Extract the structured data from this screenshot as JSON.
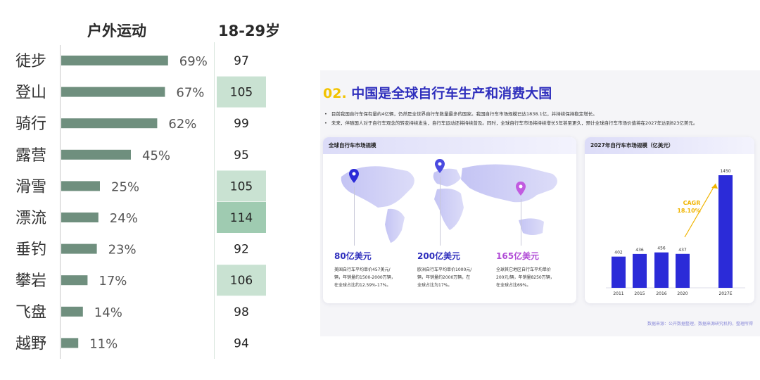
{
  "left": {
    "header_left": "户外运动",
    "header_right": "18-29岁",
    "colors": {
      "bar": "#6f8f7e",
      "hl_light": "#c9e2d2",
      "hl_strong": "#9fcbb1"
    },
    "chart_data": {
      "type": "bar",
      "categories": [
        "徒步",
        "登山",
        "骑行",
        "露营",
        "滑雪",
        "漂流",
        "垂钓",
        "攀岩",
        "飞盘",
        "越野"
      ],
      "values": [
        69,
        67,
        62,
        45,
        25,
        24,
        23,
        17,
        14,
        11
      ],
      "value_labels": [
        "69%",
        "67%",
        "62%",
        "45%",
        "25%",
        "24%",
        "23%",
        "17%",
        "14%",
        "11%"
      ],
      "age_18_29_index": [
        "97",
        "105",
        "99",
        "95",
        "105",
        "114",
        "92",
        "106",
        "98",
        "94"
      ],
      "highlight": [
        "none",
        "light",
        "none",
        "none",
        "light",
        "strong",
        "none",
        "light",
        "none",
        "none"
      ],
      "title": "户外运动",
      "column_title": "18-29岁"
    }
  },
  "right": {
    "title_num": "02.",
    "title_text": "中国是全球自行车生产和消费大国",
    "bullets": [
      "目前我国自行车保有量约4亿辆，仍然是全世界自行车数量最多的国家。我国自行车市场规模已达1838.1亿，并持续保持稳定增长。",
      "未来，伴随国人对于自行车观念的转变持续发生，自行车运动还将持续普及。同时，全球自行车市场将持续增长5年甚至更久，预计全球自行车市场价值将在2027年达到823亿美元。"
    ],
    "map_card": {
      "header": "全球自行车市场规模",
      "stats": [
        {
          "value": "80亿美元",
          "color": "#2f2fbd",
          "desc": "美国自行车平均单价457美元/\n辆，年销量约1500-2000万辆，\n在全球占比约12.59%-17%。"
        },
        {
          "value": "200亿美元",
          "color": "#2f2fbd",
          "desc": "欧洲自行车平均单价1000元/\n辆，年销量约2000万辆，在\n全球占比为17%。"
        },
        {
          "value": "165亿美元",
          "color": "#b04bd6",
          "desc": "全球其它地区自行车平均单价\n200元/辆，年销量8250万辆，\n在全球占比69%。"
        }
      ]
    },
    "bar_card": {
      "header": "2027年自行车市场规模（亿美元）",
      "cagr_label": "CAGR",
      "cagr_value": "18.10%",
      "bar_color": "#2b2bd8",
      "chart_data": {
        "type": "bar",
        "categories": [
          "2011",
          "2015",
          "2016",
          "2020",
          "2027E"
        ],
        "values": [
          402,
          436,
          456,
          437,
          1450
        ],
        "title": "2027年自行车市场规模（亿美元）"
      }
    },
    "footer": "数据来源：公开数据整理，数据来源研究机构，整理所得"
  }
}
